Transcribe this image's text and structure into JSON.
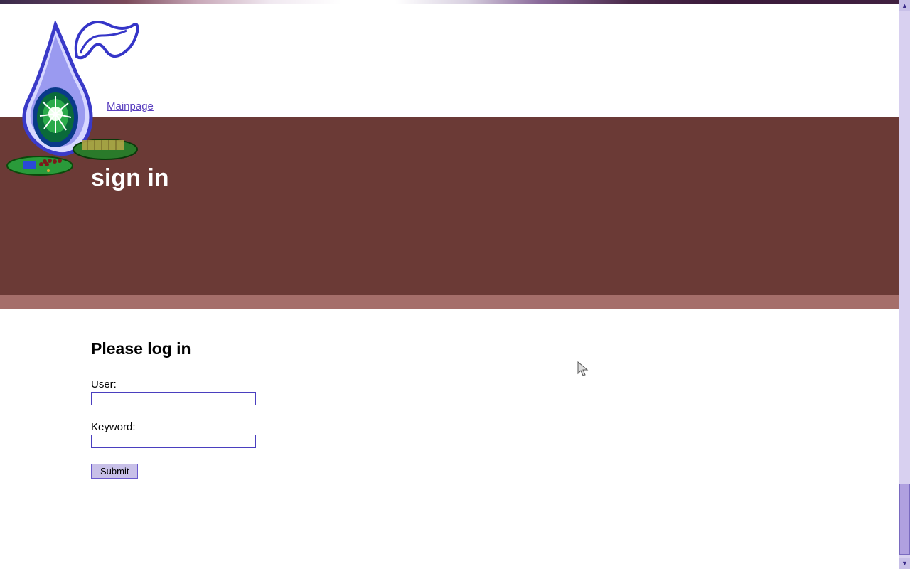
{
  "nav": {
    "mainpage": "Mainpage"
  },
  "banner": {
    "title": "sign in"
  },
  "login": {
    "heading": "Please log in",
    "user_label": "User:",
    "keyword_label": "Keyword:",
    "user_value": "",
    "keyword_value": "",
    "submit_label": "Submit"
  },
  "colors": {
    "banner_bg": "#6b3a36",
    "strip_bg": "#a56e6a",
    "link": "#5a3fbf",
    "input_border": "#4a3fbf",
    "button_bg": "#c8c0e8"
  }
}
